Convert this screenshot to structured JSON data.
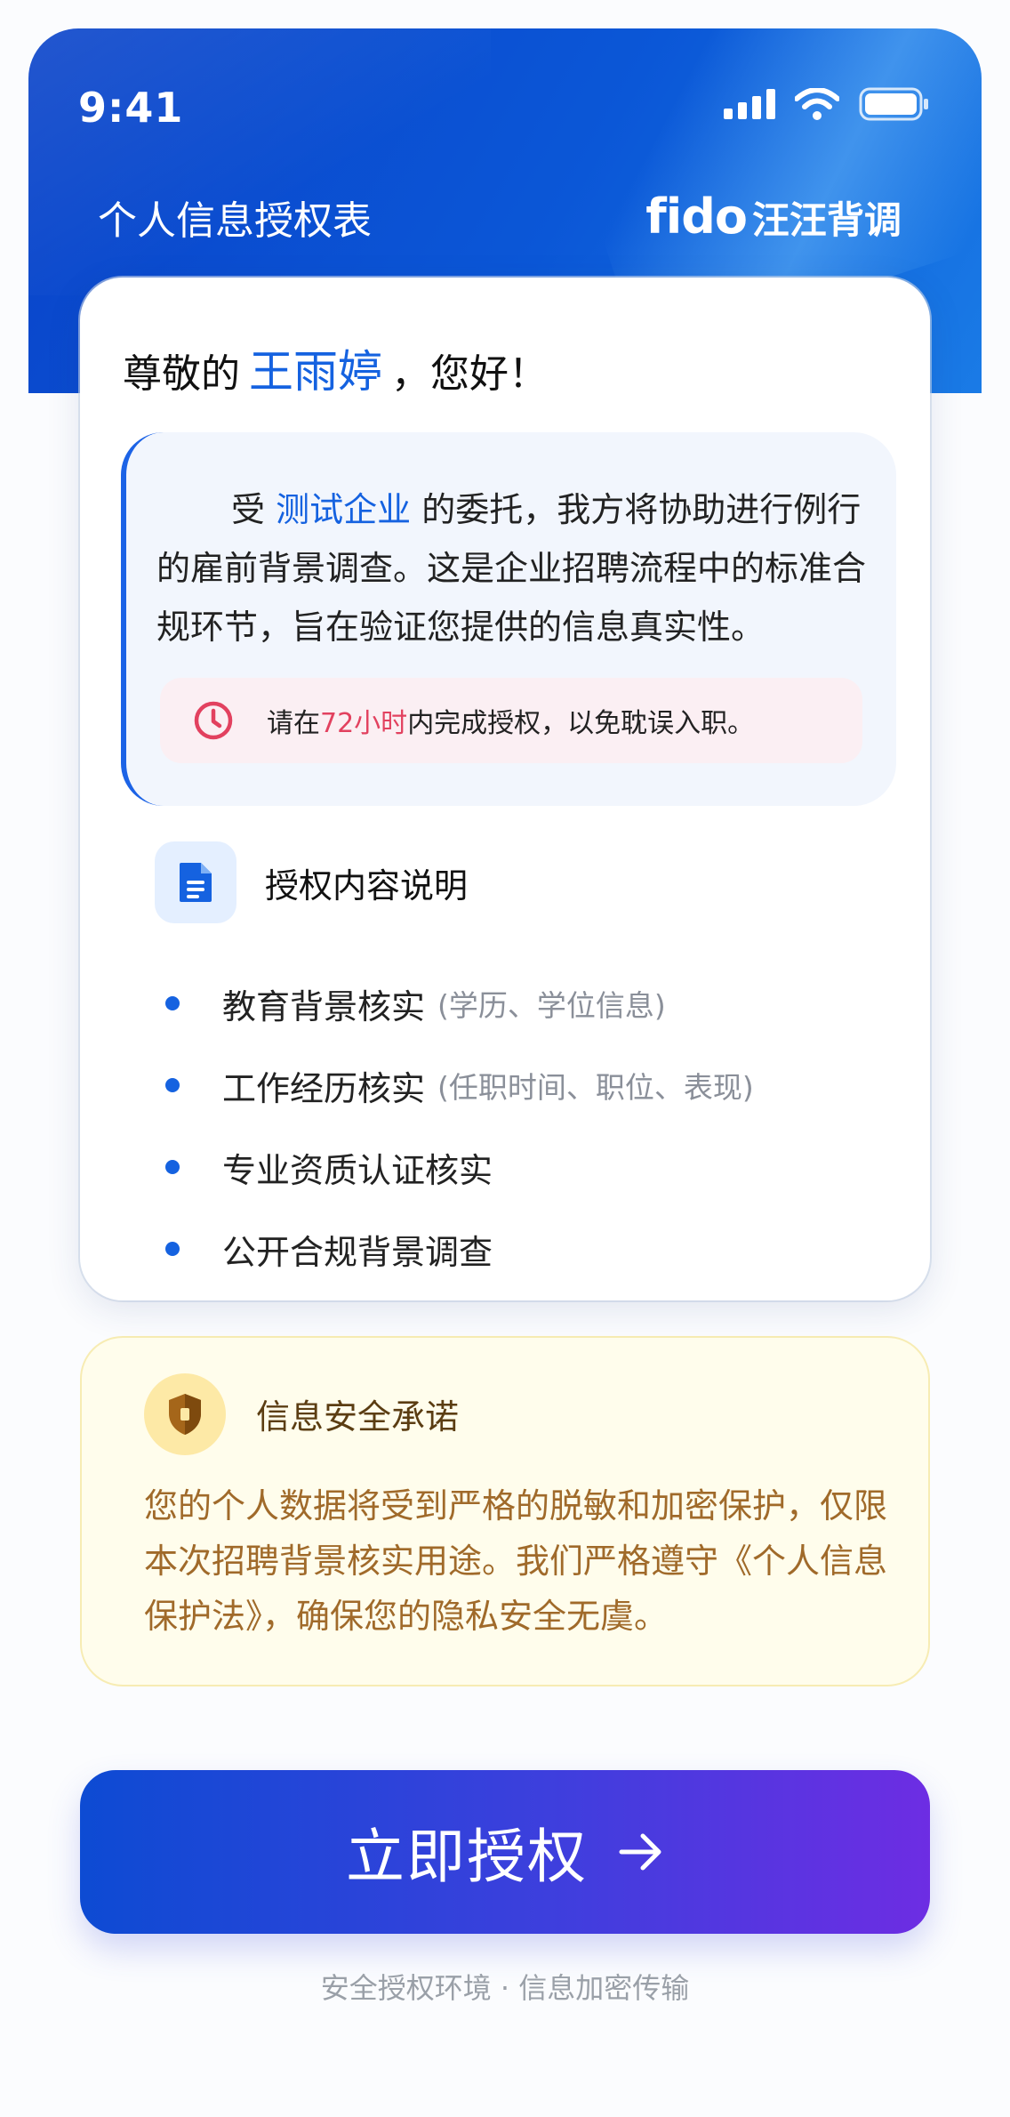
{
  "status_bar": {
    "time": "9:41"
  },
  "header": {
    "title": "个人信息授权表",
    "brand_en": "fido",
    "brand_cn": "汪汪背调"
  },
  "greeting": {
    "prefix": "尊敬的",
    "name": "王雨婷",
    "suffix": "，您好！"
  },
  "notice": {
    "prefix": "受",
    "company": "测试企业",
    "body": "的委托，我方将协助进行例行的雇前背景调查。这是企业招聘流程中的标准合规环节，旨在验证您提供的信息真实性。"
  },
  "deadline": {
    "prefix": "请在",
    "highlight": "72小时",
    "suffix": "内完成授权，以免耽误入职。"
  },
  "authorization": {
    "title": "授权内容说明",
    "items": [
      {
        "label": "教育背景核实",
        "note": "(学历、学位信息)"
      },
      {
        "label": "工作经历核实",
        "note": "(任职时间、职位、表现)"
      },
      {
        "label": "专业资质认证核实",
        "note": ""
      },
      {
        "label": "公开合规背景调查",
        "note": ""
      }
    ]
  },
  "security": {
    "title": "信息安全承诺",
    "body": "您的个人数据将受到严格的脱敏和加密保护，仅限本次招聘背景核实用途。我们严格遵守《个人信息保护法》，确保您的隐私安全无虞。"
  },
  "cta": {
    "label": "立即授权"
  },
  "footer": {
    "note": "安全授权环境 · 信息加密传输"
  },
  "icons": {
    "signal": "signal-icon",
    "wifi": "wifi-icon",
    "battery": "battery-icon",
    "clock": "clock-icon",
    "document": "document-icon",
    "shield": "shield-icon",
    "arrow": "arrow-right-icon"
  },
  "colors": {
    "primary": "#1562e0",
    "deadline_highlight": "#e2415f",
    "security_text": "#a06a2a",
    "security_title": "#5b3d12"
  }
}
